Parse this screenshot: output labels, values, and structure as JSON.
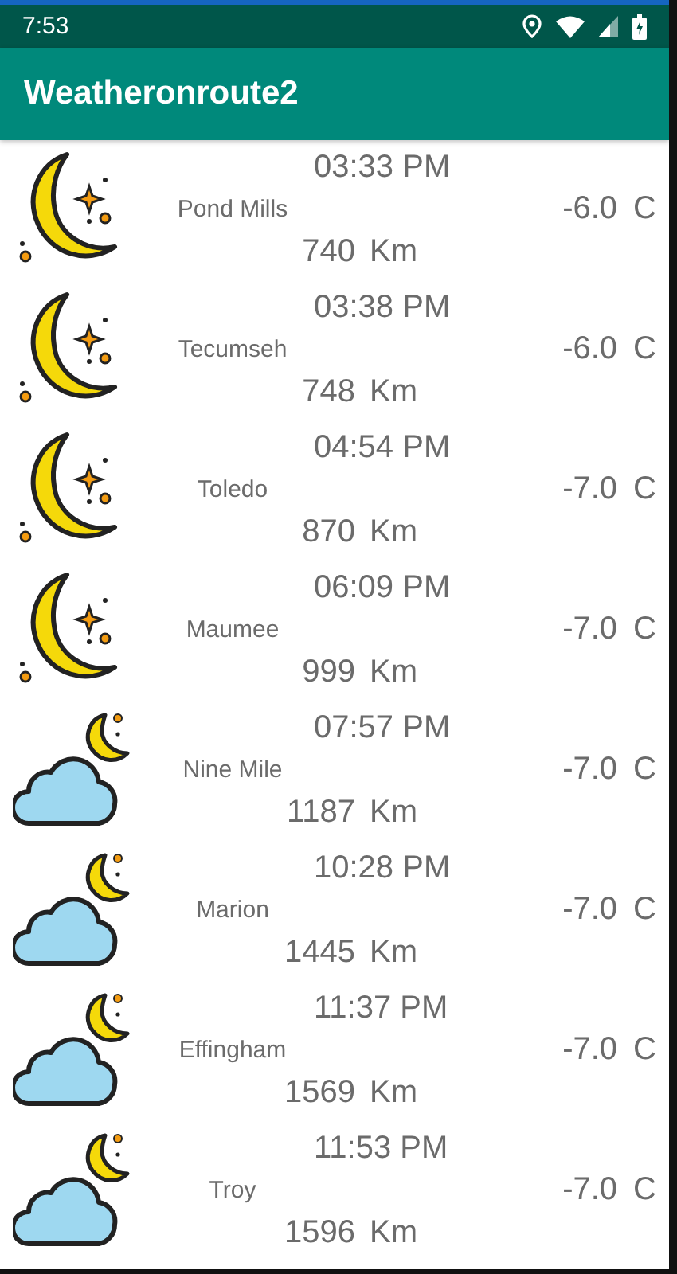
{
  "status_bar": {
    "time": "7:53"
  },
  "app_bar": {
    "title": "Weatheronroute2"
  },
  "rows": [
    {
      "kind": "moon",
      "time": "03:33 PM",
      "place": "Pond Mills",
      "distance": "740",
      "distance_unit": "Km",
      "temperature": "-6.0",
      "temperature_unit": "C"
    },
    {
      "kind": "moon",
      "time": "03:38 PM",
      "place": "Tecumseh",
      "distance": "748",
      "distance_unit": "Km",
      "temperature": "-6.0",
      "temperature_unit": "C"
    },
    {
      "kind": "moon",
      "time": "04:54 PM",
      "place": "Toledo",
      "distance": "870",
      "distance_unit": "Km",
      "temperature": "-7.0",
      "temperature_unit": "C"
    },
    {
      "kind": "moon",
      "time": "06:09 PM",
      "place": "Maumee",
      "distance": "999",
      "distance_unit": "Km",
      "temperature": "-7.0",
      "temperature_unit": "C"
    },
    {
      "kind": "cloud-moon",
      "time": "07:57 PM",
      "place": "Nine Mile",
      "distance": "1187",
      "distance_unit": "Km",
      "temperature": "-7.0",
      "temperature_unit": "C"
    },
    {
      "kind": "cloud-moon",
      "time": "10:28 PM",
      "place": "Marion",
      "distance": "1445",
      "distance_unit": "Km",
      "temperature": "-7.0",
      "temperature_unit": "C"
    },
    {
      "kind": "cloud-moon",
      "time": "11:37 PM",
      "place": "Effingham",
      "distance": "1569",
      "distance_unit": "Km",
      "temperature": "-7.0",
      "temperature_unit": "C"
    },
    {
      "kind": "cloud-moon",
      "time": "11:53 PM",
      "place": "Troy",
      "distance": "1596",
      "distance_unit": "Km",
      "temperature": "-7.0",
      "temperature_unit": "C"
    }
  ]
}
